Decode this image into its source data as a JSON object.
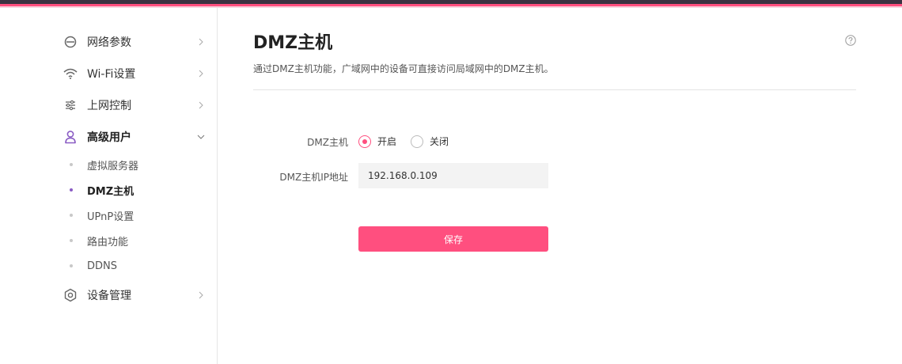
{
  "colors": {
    "accent": "#ff4f7f",
    "topbar": "#3b3342",
    "active_dot": "#8a5cc4"
  },
  "sidebar": {
    "items": [
      {
        "label": "网络参数",
        "icon": "internet-e-icon"
      },
      {
        "label": "Wi-Fi设置",
        "icon": "wifi-icon"
      },
      {
        "label": "上网控制",
        "icon": "sliders-icon"
      },
      {
        "label": "高级用户",
        "icon": "user-icon",
        "expanded": true
      },
      {
        "label": "设备管理",
        "icon": "gear-icon"
      }
    ],
    "sub_items": [
      {
        "label": "虚拟服务器"
      },
      {
        "label": "DMZ主机",
        "active": true
      },
      {
        "label": "UPnP设置"
      },
      {
        "label": "路由功能"
      },
      {
        "label": "DDNS"
      }
    ]
  },
  "main": {
    "title": "DMZ主机",
    "description": "通过DMZ主机功能，广域网中的设备可直接访问局域网中的DMZ主机。",
    "help_icon": "question-circle-icon",
    "form": {
      "dmz_label": "DMZ主机",
      "option_on": "开启",
      "option_off": "关闭",
      "selected": "开启",
      "ip_label": "DMZ主机IP地址",
      "ip_value": "192.168.0.109",
      "save_label": "保存"
    }
  }
}
